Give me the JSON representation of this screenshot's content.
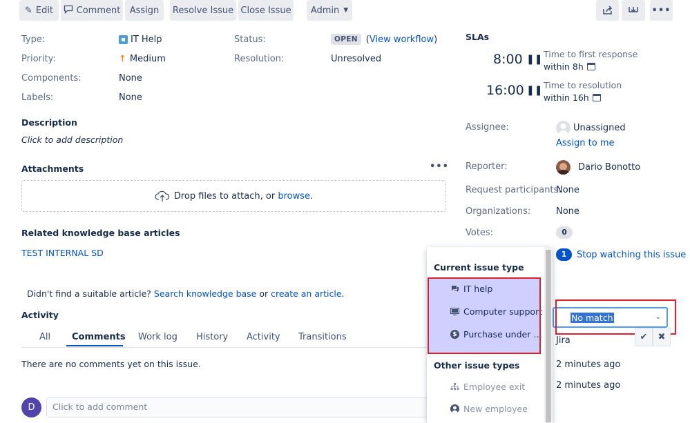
{
  "toolbar": {
    "edit": "Edit",
    "comment": "Comment",
    "assign": "Assign",
    "resolve": "Resolve Issue",
    "close": "Close Issue",
    "admin": "Admin"
  },
  "details": {
    "type_label": "Type:",
    "type_value": "IT Help",
    "priority_label": "Priority:",
    "priority_value": "Medium",
    "components_label": "Components:",
    "components_value": "None",
    "labels_label": "Labels:",
    "labels_value": "None",
    "status_label": "Status:",
    "status_value": "OPEN",
    "view_workflow_open": "(",
    "view_workflow": "View workflow",
    "view_workflow_close": ")",
    "resolution_label": "Resolution:",
    "resolution_value": "Unresolved"
  },
  "description": {
    "heading": "Description",
    "placeholder": "Click to add description"
  },
  "attachments": {
    "heading": "Attachments",
    "drop_text": "Drop files to attach, or ",
    "browse": "browse",
    "period": "."
  },
  "kb": {
    "heading": "Related knowledge base articles",
    "article": "TEST INTERNAL SD",
    "not_found": "Didn't find a suitable article? ",
    "search": "Search knowledge base",
    "or": " or ",
    "create": "create an article",
    "end": "."
  },
  "activity": {
    "heading": "Activity",
    "tabs": [
      "All",
      "Comments",
      "Work log",
      "History",
      "Activity",
      "Transitions"
    ],
    "empty": "There are no comments yet on this issue.",
    "avatar_letter": "D",
    "add_comment": "Click to add comment"
  },
  "slas": {
    "heading": "SLAs",
    "items": [
      {
        "time": "8:00",
        "name": "Time to first response",
        "within": "within 8h"
      },
      {
        "time": "16:00",
        "name": "Time to resolution",
        "within": "within 16h"
      }
    ]
  },
  "people": {
    "assignee_label": "Assignee:",
    "assignee_value": "Unassigned",
    "assign_to_me": "Assign to me",
    "reporter_label": "Reporter:",
    "reporter_value": "Dario Bonotto",
    "participants_label": "Request participants:",
    "participants_value": "None",
    "organizations_label": "Organizations:",
    "organizations_value": "None",
    "votes_label": "Votes:",
    "votes_value": "0",
    "watch_count": "1",
    "watch_text": "Stop watching this issue"
  },
  "dates": {
    "jira": "Jira",
    "created": "2 minutes ago",
    "updated": "2 minutes ago"
  },
  "request_type": {
    "select_value": "No match"
  },
  "dropdown": {
    "current_heading": "Current issue type",
    "current_items": [
      {
        "label": "IT help",
        "icon": "chat-icon"
      },
      {
        "label": "Computer support",
        "icon": "monitor-icon"
      },
      {
        "label": "Purchase under …",
        "icon": "dollar-icon"
      }
    ],
    "other_heading": "Other issue types",
    "other_items": [
      {
        "label": "Employee exit",
        "icon": "org-chart-icon"
      },
      {
        "label": "New employee",
        "icon": "person-icon"
      }
    ]
  },
  "colors": {
    "link": "#0052cc",
    "highlight": "#d0d0ff",
    "annotation_red": "#e01e2d"
  }
}
